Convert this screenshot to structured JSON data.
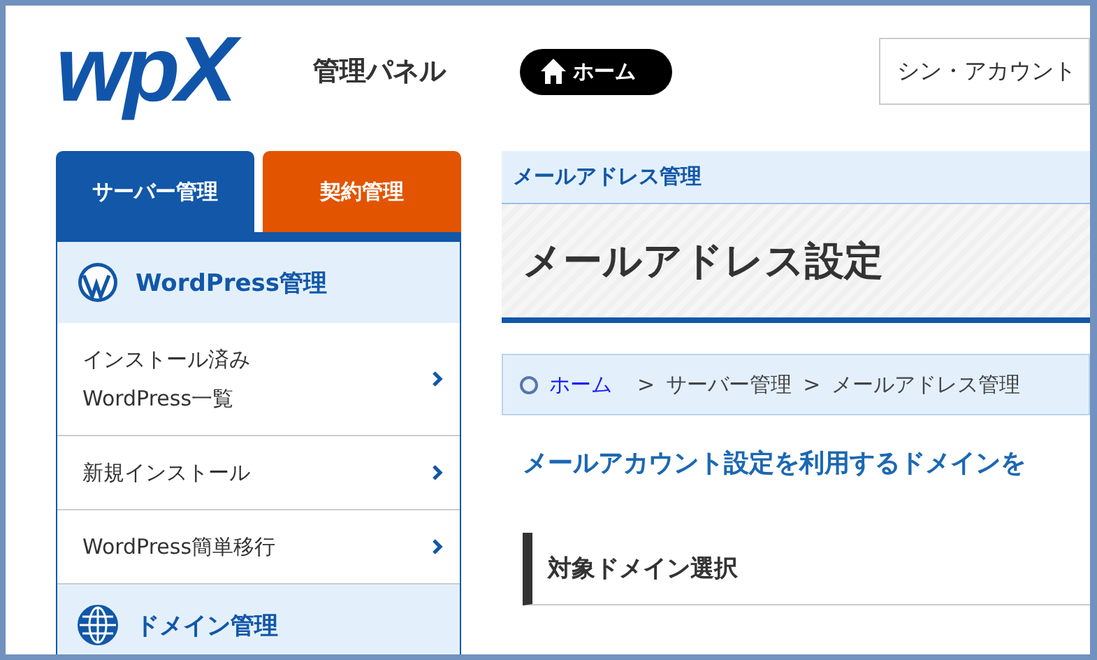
{
  "header": {
    "logo": "wpX",
    "title": "管理パネル",
    "home_button": "ホーム",
    "account_field": "シン・アカウント"
  },
  "sidebar": {
    "tabs": [
      {
        "label": "サーバー管理",
        "selected": true
      },
      {
        "label": "契約管理",
        "selected": false
      }
    ],
    "sections": [
      {
        "title": "WordPress管理",
        "items": [
          {
            "lines": [
              "インストール済み",
              "WordPress一覧"
            ]
          },
          {
            "lines": [
              "新規インストール"
            ]
          },
          {
            "lines": [
              "WordPress簡単移行"
            ]
          }
        ]
      },
      {
        "title": "ドメイン管理"
      }
    ]
  },
  "main": {
    "category": "メールアドレス管理",
    "title": "メールアドレス設定",
    "breadcrumb": [
      "ホーム",
      "サーバー管理",
      "メールアドレス管理"
    ],
    "breadcrumb_separators": [
      ">",
      ">"
    ],
    "lead": "メールアカウント設定を利用するドメインを",
    "section_heading": "対象ドメイン選択"
  }
}
